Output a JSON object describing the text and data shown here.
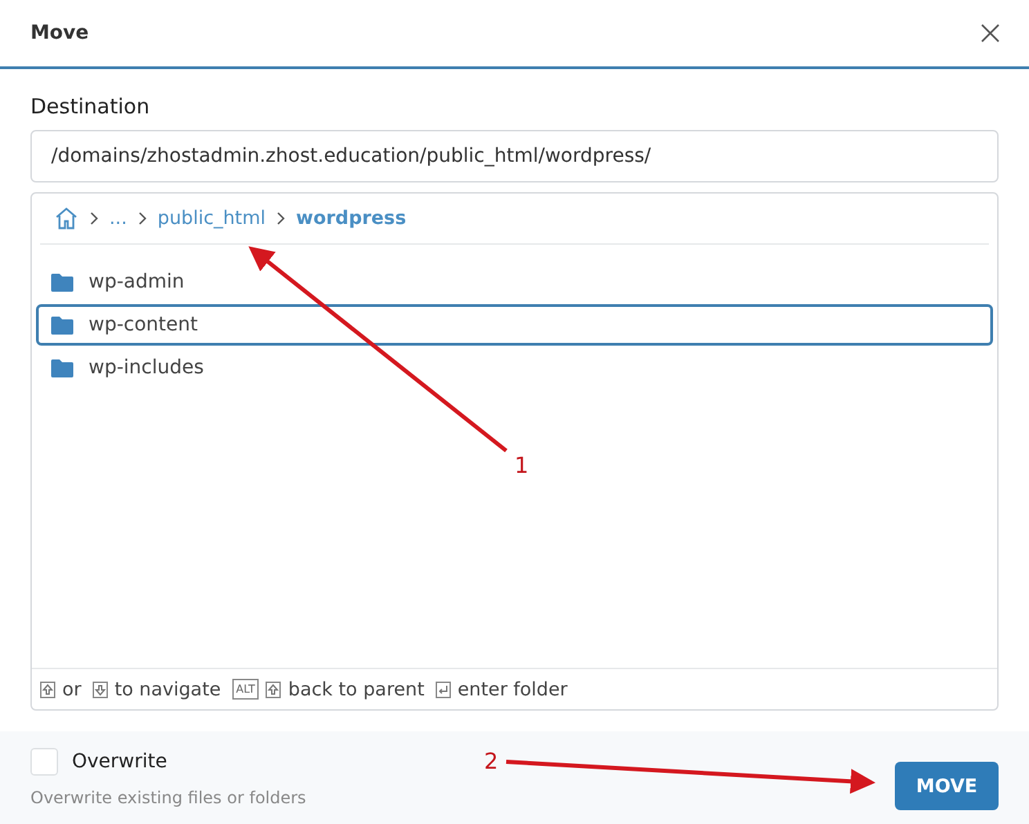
{
  "dialog": {
    "title": "Move"
  },
  "destination": {
    "label": "Destination",
    "value": "/domains/zhostadmin.zhost.education/public_html/wordpress/"
  },
  "breadcrumb": [
    {
      "kind": "home"
    },
    {
      "kind": "crumb",
      "text": "...",
      "current": false
    },
    {
      "kind": "crumb",
      "text": "public_html",
      "current": false
    },
    {
      "kind": "crumb",
      "text": "wordpress",
      "current": true
    }
  ],
  "folders": [
    {
      "name": "wp-admin",
      "selected": false
    },
    {
      "name": "wp-content",
      "selected": true
    },
    {
      "name": "wp-includes",
      "selected": false
    }
  ],
  "hints": [
    {
      "kind": "up-key"
    },
    {
      "kind": "text",
      "text": "or"
    },
    {
      "kind": "down-key"
    },
    {
      "kind": "text",
      "text": "to navigate"
    },
    {
      "kind": "label-key",
      "text": "ALT"
    },
    {
      "kind": "up-key"
    },
    {
      "kind": "text",
      "text": "back to parent"
    },
    {
      "kind": "enter-key"
    },
    {
      "kind": "text",
      "text": "enter folder"
    }
  ],
  "overwrite": {
    "label": "Overwrite",
    "checked": false,
    "help": "Overwrite existing files or folders"
  },
  "buttons": [
    "MOVE"
  ],
  "annotations": [
    {
      "number": "1"
    },
    {
      "number": "2"
    }
  ]
}
